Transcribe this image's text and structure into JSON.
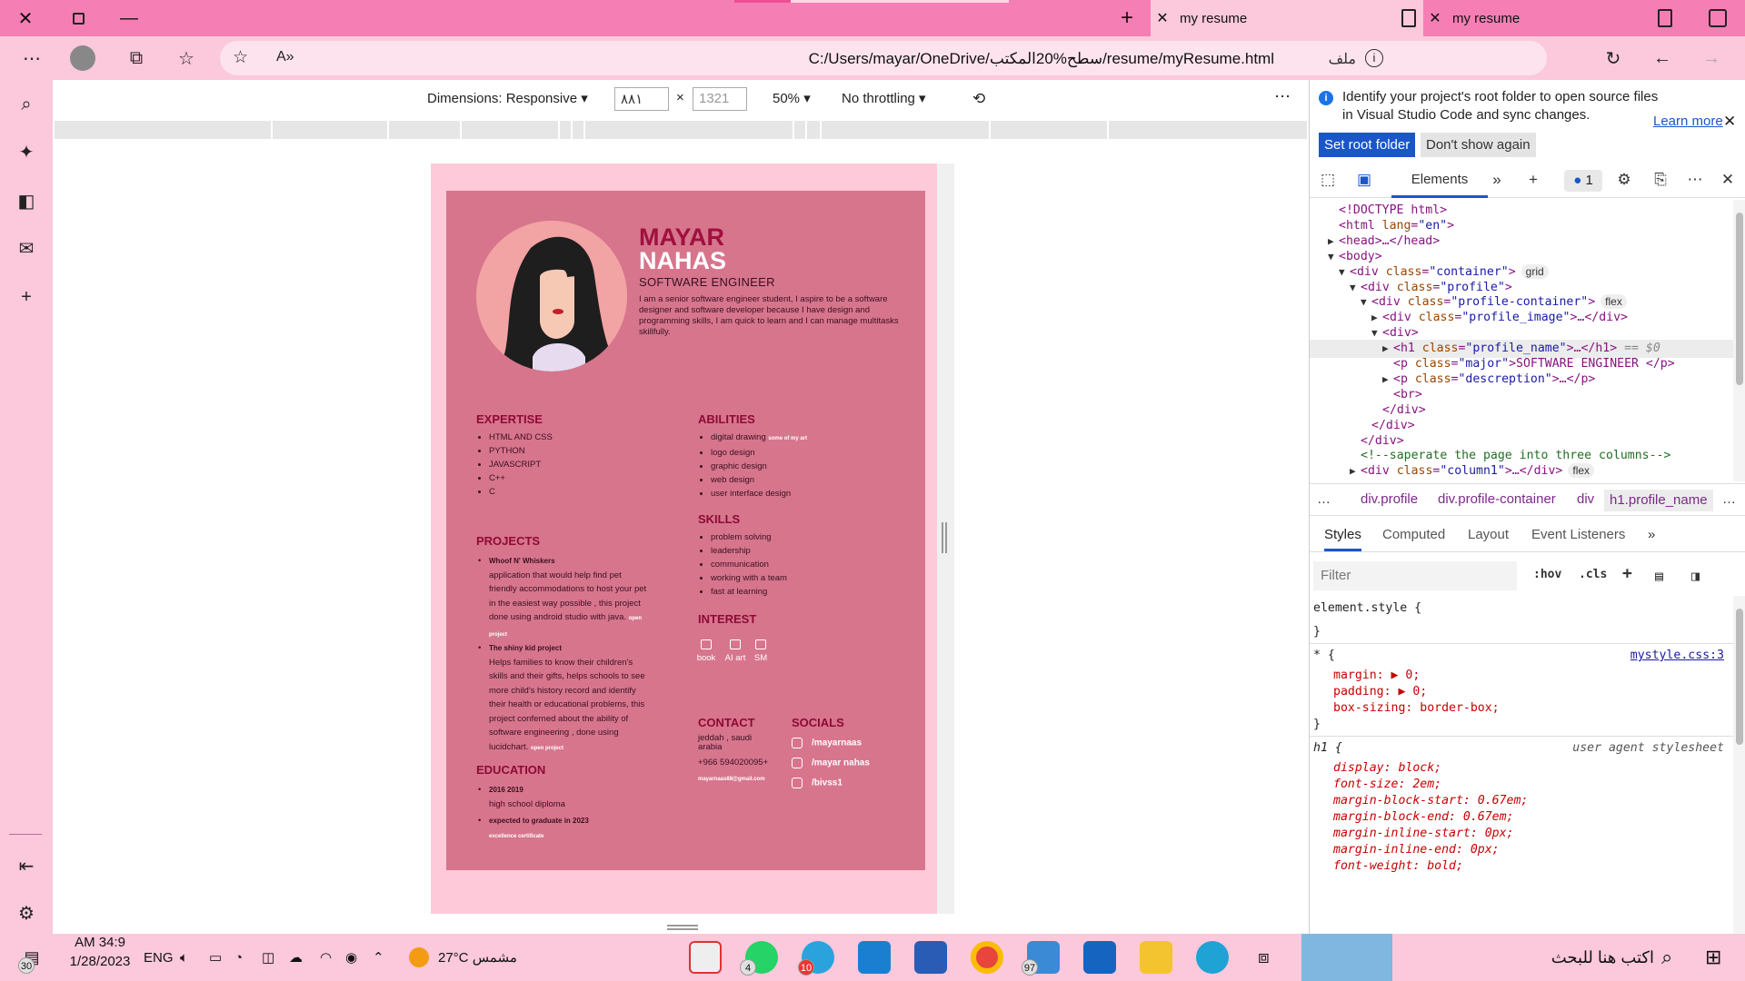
{
  "browser": {
    "tabs": [
      {
        "title": "my resume"
      },
      {
        "title": "my resume"
      }
    ],
    "address": "C:/Users/mayar/OneDrive/سطح%20المكتب/resume/myResume.html",
    "address_label": "ملف",
    "accent": "#f57fb5"
  },
  "device_toolbar": {
    "dimensions_label": "Dimensions: Responsive",
    "width_value": "٨٨١",
    "height_value": "1321",
    "times": "×",
    "zoom": "50%",
    "throttling": "No throttling",
    "more": "⋮"
  },
  "resume": {
    "first_name": "MAYAR",
    "last_name": "NAHAS",
    "major": "SOFTWARE ENGINEER",
    "description": "I am a senior software engineer student, I aspire to be a software designer and software developer because I have design and programming skills, I am quick to learn and I can manage multitasks skillfully.",
    "expertise_title": "EXPERTISE",
    "expertise": [
      "HTML AND CSS",
      "PYTHON",
      "JAVASCRIPT",
      "C++",
      "C"
    ],
    "abilities_title": "ABILITIES",
    "abilities": [
      "digital drawing",
      "logo design",
      "graphic design",
      "web design",
      "user interface design"
    ],
    "abilities_note": "some of my art",
    "skills_title": "SKILLS",
    "skills": [
      "problem solving",
      "leadership",
      "communication",
      "working with a team",
      "fast at learning"
    ],
    "interest_title": "INTEREST",
    "interests": [
      "book",
      "AI art",
      "SM"
    ],
    "projects_title": "PROJECTS",
    "projects": [
      {
        "name": "Whoof N' Whiskers",
        "text": "application that would help find pet friendly accommodations to host your pet in the easiest way possible , this project done using android studio with java.",
        "link": "open project"
      },
      {
        "name": "The shiny kid project",
        "text": "Helps families to know their children's skills and their gifts, helps schools to see more child's history record and identify their health or educational problems, this project conferned about the ability of software engineering , done using lucidchart.",
        "link": "open project"
      }
    ],
    "education_title": "EDUCATION",
    "education": [
      {
        "year": "2016 2019",
        "text": "high school diploma"
      },
      {
        "year": "expected to graduate in 2023",
        "text": "excellence certificate"
      }
    ],
    "contact_title": "CONTACT",
    "contact_city": "jeddah , saudi arabia",
    "contact_phone": "+966 594020095+",
    "contact_email": "mayarnaas88@gmail.com",
    "socials_title": "SOCIALS",
    "socials": [
      "/mayarnaas",
      "/mayar nahas",
      "/bivss1"
    ],
    "colors": {
      "page": "#fec9d9",
      "card": "#d7758d",
      "accent": "#a0103f"
    }
  },
  "devtools": {
    "banner": "Identify your project's root folder to open source files in Visual Studio Code and sync changes.",
    "learn_more": "Learn more",
    "set_root": "Set root folder",
    "dont_show": "Don't show again",
    "elements_tab": "Elements",
    "issues_count": "1",
    "dom": [
      {
        "indent": 1,
        "tri": "",
        "text": "<!DOCTYPE html>"
      },
      {
        "indent": 1,
        "tri": "",
        "text": "<html lang=\"en\">"
      },
      {
        "indent": 1,
        "tri": "▶",
        "text": "<head>…</head>"
      },
      {
        "indent": 1,
        "tri": "▼",
        "text": "<body>"
      },
      {
        "indent": 2,
        "tri": "▼",
        "text": "<div class=\"container\">",
        "badge": "grid"
      },
      {
        "indent": 3,
        "tri": "▼",
        "text": "<div class=\"profile\">"
      },
      {
        "indent": 4,
        "tri": "▼",
        "text": "<div class=\"profile-container\">",
        "badge": "flex"
      },
      {
        "indent": 5,
        "tri": "▶",
        "text": "<div class=\"profile_image\">…</div>"
      },
      {
        "indent": 5,
        "tri": "▼",
        "text": "<div>"
      },
      {
        "indent": 6,
        "tri": "▶",
        "text": "<h1 class=\"profile_name\">…</h1>",
        "suffix": " == $0",
        "selected": true
      },
      {
        "indent": 6,
        "tri": "",
        "text": "<p class=\"major\">SOFTWARE ENGINEER </p>"
      },
      {
        "indent": 6,
        "tri": "▶",
        "text": "<p class=\"descreption\">…</p>"
      },
      {
        "indent": 6,
        "tri": "",
        "text": "<br>"
      },
      {
        "indent": 5,
        "tri": "",
        "text": "</div>"
      },
      {
        "indent": 4,
        "tri": "",
        "text": "</div>"
      },
      {
        "indent": 3,
        "tri": "",
        "text": "</div>"
      },
      {
        "indent": 3,
        "tri": "",
        "text": "<!--saperate the page into three columns-->",
        "comment": true
      },
      {
        "indent": 3,
        "tri": "▶",
        "text": "<div class=\"column1\">…</div>",
        "badge": "flex"
      }
    ],
    "breadcrumbs": [
      "…",
      "div.profile",
      "div.profile-container",
      "div",
      "h1.profile_name",
      "…"
    ],
    "style_tabs": [
      "Styles",
      "Computed",
      "Layout",
      "Event Listeners"
    ],
    "filter_placeholder": "Filter",
    "hov": ":hov",
    "cls": ".cls",
    "styles": {
      "element_style": "element.style {",
      "close_brace": "}",
      "star_selector": "* {",
      "star_source": "mystyle.css:3",
      "star_props": [
        "margin: ▶ 0;",
        "padding: ▶ 0;",
        "box-sizing: border-box;"
      ],
      "h1_selector": "h1 {",
      "h1_source": "user agent stylesheet",
      "h1_props": [
        "display: block;",
        "font-size: 2em;",
        "margin-block-start: 0.67em;",
        "margin-block-end: 0.67em;",
        "margin-inline-start: 0px;",
        "margin-inline-end: 0px;",
        "font-weight: bold;"
      ]
    }
  },
  "taskbar": {
    "time": "AM 34:9",
    "date": "1/28/2023",
    "lang": "ENG",
    "weather": "27°C  مشمس",
    "search_placeholder": "اكتب هنا للبحث",
    "notif_count": "30",
    "whatsapp_badge": "4",
    "telegram_badge": "10",
    "mail_badge": "97"
  }
}
